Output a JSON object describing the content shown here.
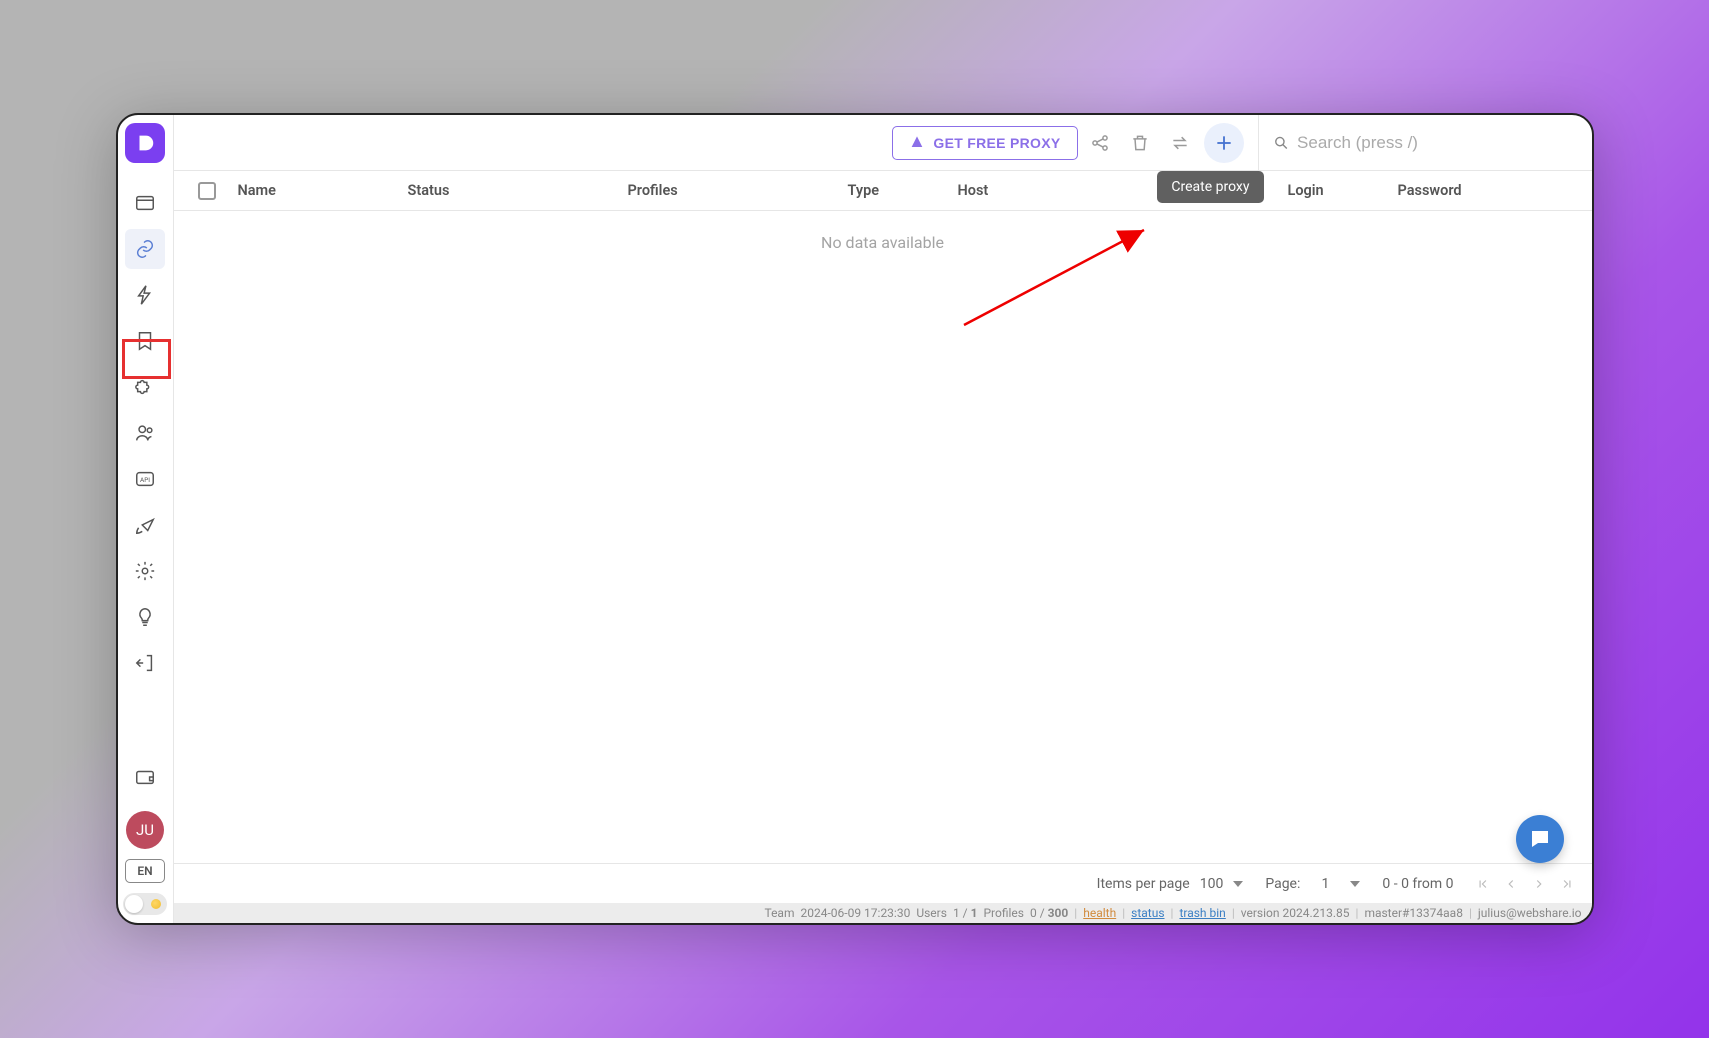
{
  "toolbar": {
    "get_proxy_label": "GET FREE PROXY",
    "create_tooltip": "Create proxy",
    "search_placeholder": "Search (press /)"
  },
  "columns": {
    "name": "Name",
    "status": "Status",
    "profiles": "Profiles",
    "type": "Type",
    "host": "Host",
    "login": "Login",
    "password": "Password"
  },
  "empty_text": "No data available",
  "footer": {
    "ipp_label": "Items per page",
    "ipp_value": "100",
    "page_label": "Page:",
    "page_value": "1",
    "range_text": "0 - 0 from 0"
  },
  "sidebar": {
    "avatar_initials": "JU",
    "lang": "EN"
  },
  "statusbar": {
    "team": "Team",
    "timestamp": "2024-06-09 17:23:30",
    "users_label": "Users",
    "users_used": "1",
    "users_total": "1",
    "profiles_label": "Profiles",
    "profiles_used": "0",
    "profiles_total": "300",
    "health": "health",
    "status": "status",
    "trashbin": "trash bin",
    "version": "version 2024.213.85",
    "build": "master#13374aa8",
    "email": "julius@webshare.io"
  }
}
